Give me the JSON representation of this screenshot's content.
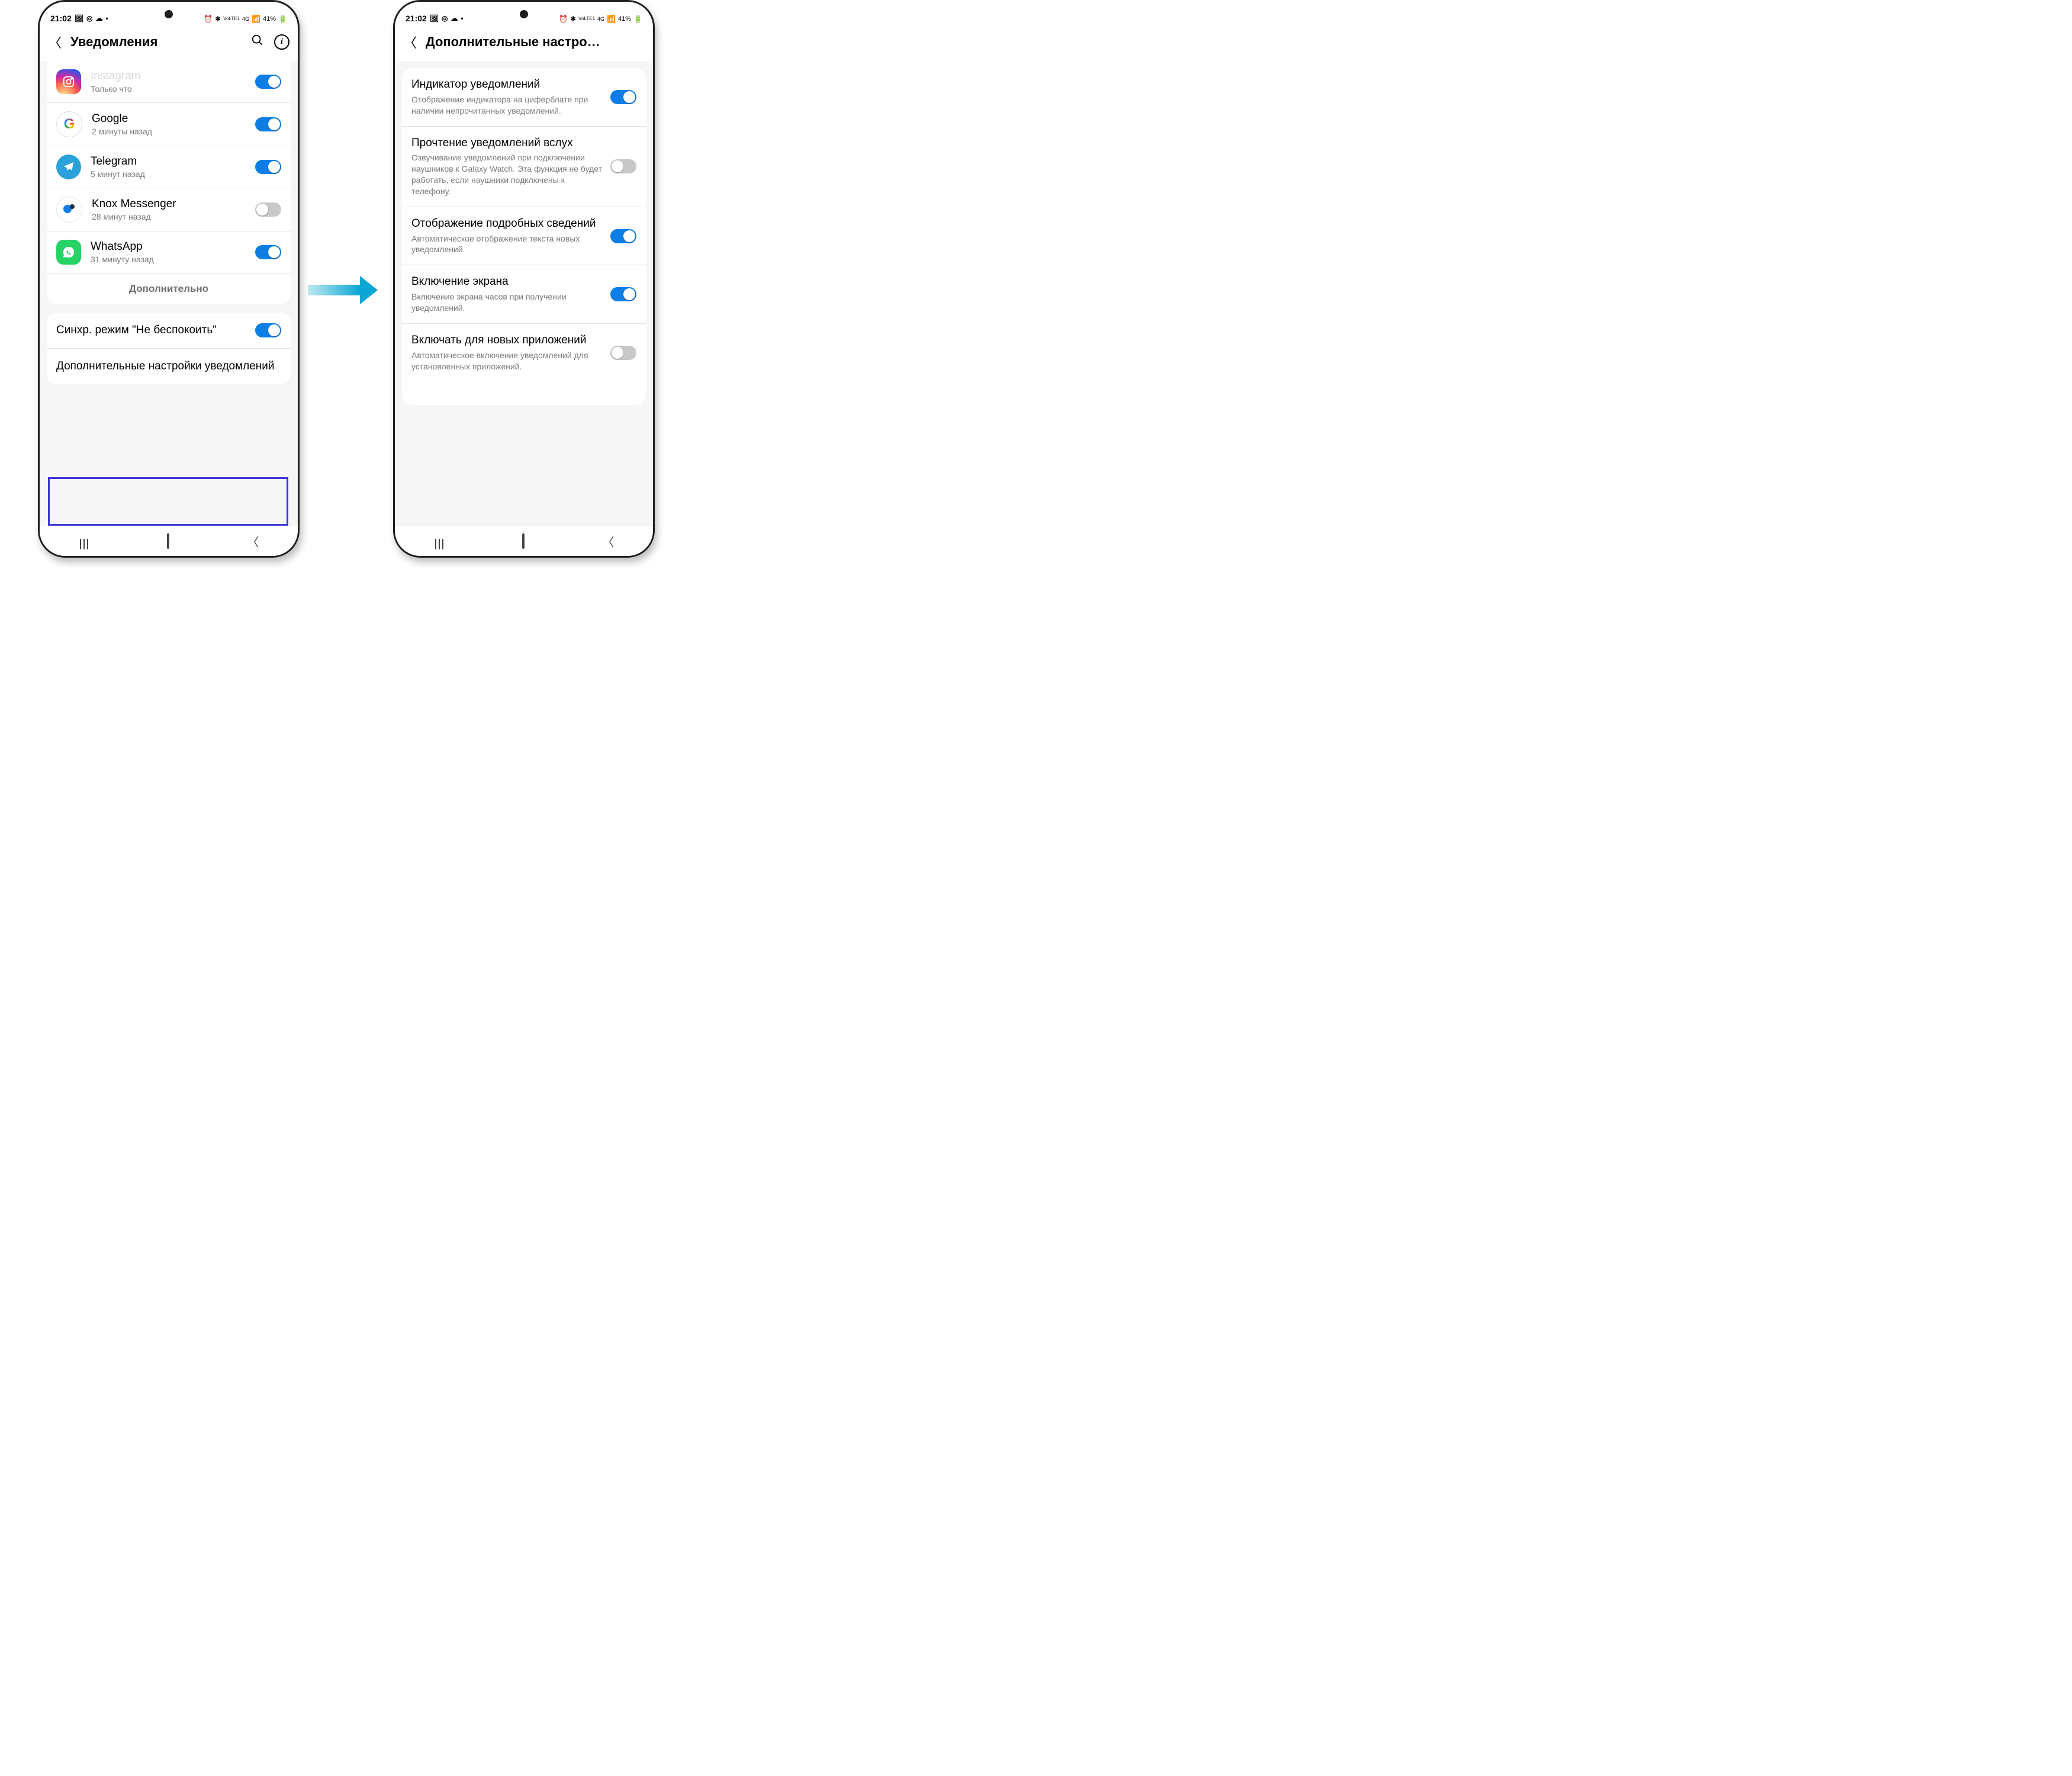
{
  "status": {
    "time": "21:02",
    "battery": "41%",
    "net": "4G",
    "lte": "VoLTE1"
  },
  "left": {
    "title": "Уведомления",
    "apps": [
      {
        "name": "Instagram",
        "sub": "Только что",
        "icon": "instagram",
        "on": true
      },
      {
        "name": "Google",
        "sub": "2 минуты назад",
        "icon": "google",
        "on": true
      },
      {
        "name": "Telegram",
        "sub": "5 минут назад",
        "icon": "telegram",
        "on": true
      },
      {
        "name": "Knox Messenger",
        "sub": "28 минут назад",
        "icon": "knox",
        "on": false
      },
      {
        "name": "WhatsApp",
        "sub": "31 минуту назад",
        "icon": "whatsapp",
        "on": true
      }
    ],
    "more": "Дополнительно",
    "sync_dnd": "Синхр. режим \"Не беспокоить\"",
    "advanced": "Дополнительные настройки уведомлений"
  },
  "right": {
    "title": "Дополнительные настро…",
    "items": [
      {
        "title": "Индикатор уведомлений",
        "sub": "Отображение индикатора на циферблате при наличии непрочитанных уведомлений.",
        "on": true
      },
      {
        "title": "Прочтение уведомлений вслух",
        "sub": "Озвучивание уведомлений при подключении наушников к Galaxy Watch. Эта функция не будет работать, если наушники подключены к телефону.",
        "on": false
      },
      {
        "title": "Отображение подробных сведений",
        "sub": "Автоматическое отображение текста новых уведомлений.",
        "on": true
      },
      {
        "title": "Включение экрана",
        "sub": "Включение экрана часов при получении уведомлений.",
        "on": true
      },
      {
        "title": "Включать для новых приложений",
        "sub": "Автоматическое включение уведомлений для установленных приложений.",
        "on": false
      }
    ]
  }
}
